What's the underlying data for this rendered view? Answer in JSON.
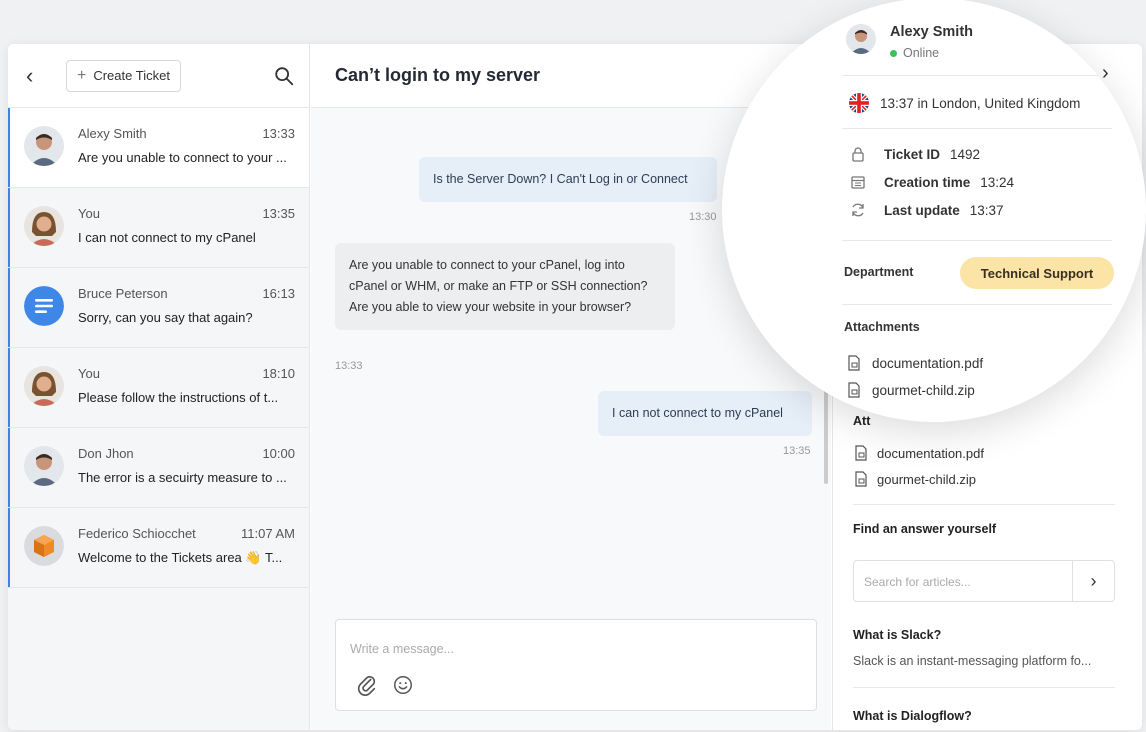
{
  "sidebar": {
    "create_label": "Create Ticket",
    "conversations": [
      {
        "name": "Alexy Smith",
        "time": "13:33",
        "message": "Are you unable to connect to your ..."
      },
      {
        "name": "You",
        "time": "13:35",
        "message": "I can not connect to my cPanel"
      },
      {
        "name": "Bruce Peterson",
        "time": "16:13",
        "message": "Sorry, can you say that again?"
      },
      {
        "name": "You",
        "time": "18:10",
        "message": "Please follow the instructions of t..."
      },
      {
        "name": "Don Jhon",
        "time": "10:00",
        "message": "The error is a secuirty measure to ..."
      },
      {
        "name": "Federico Schiocchet",
        "time": "11:07 AM",
        "message": "Welcome to the Tickets area 👋 T..."
      }
    ]
  },
  "chat": {
    "title": "Can’t login to my server",
    "messages": [
      {
        "text": "Is the Server Down? I Can't Log in or Connect",
        "time": "13:30"
      },
      {
        "text": "Are you unable to connect to your cPanel, log into cPanel or WHM, or make an FTP or SSH connection? Are you able to view your website in your browser?",
        "time": "13:33"
      },
      {
        "text": "I can not connect to my cPanel",
        "time": "13:35"
      }
    ],
    "composer_placeholder": "Write a message..."
  },
  "details": {
    "name": "Alexy Smith",
    "status": "Online",
    "location": "13:37 in London, United Kingdom",
    "ticket_id_label": "Ticket ID",
    "ticket_id": "1492",
    "creation_label": "Creation time",
    "creation_time": "13:24",
    "update_label": "Last update",
    "update_time": "13:37",
    "department_label": "Department",
    "department": "Technical Support",
    "attachments_label": "Attachments",
    "attachments_label_partial": "Att",
    "attachments": [
      "documentation.pdf",
      "gourmet-child.zip"
    ],
    "find_label": "Find an answer yourself",
    "search_placeholder": "Search for articles...",
    "articles": [
      {
        "title": "What is Slack?",
        "desc": "Slack is an instant-messaging platform fo..."
      },
      {
        "title": "What is Dialogflow?"
      }
    ]
  },
  "colors": {
    "accent": "#3a86e8",
    "online": "#3cc05a",
    "badge": "#fbe4a6",
    "outgoing_bubble": "#e6eef8"
  }
}
